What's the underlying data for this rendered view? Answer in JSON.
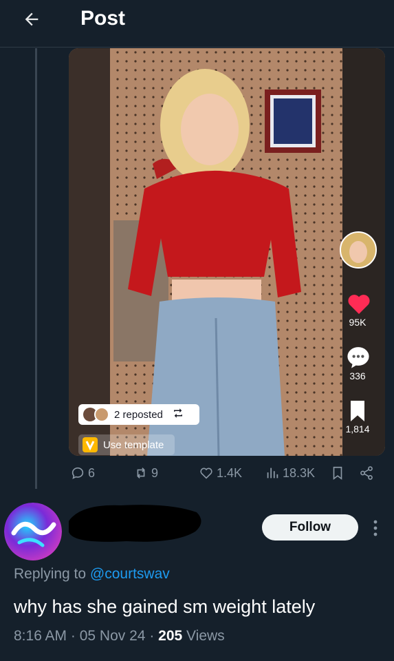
{
  "header": {
    "title": "Post",
    "back_icon": "arrow-left-icon"
  },
  "media": {
    "repost_chip": "2 reposted",
    "template_chip": "Use template",
    "side_stats": {
      "likes": "95K",
      "comments": "336",
      "saves": "1,814"
    }
  },
  "actions": {
    "replies": "6",
    "reposts": "9",
    "likes": "1.4K",
    "views": "18.3K"
  },
  "reply_post": {
    "follow_label": "Follow",
    "replying_prefix": "Replying to ",
    "replying_handle": "@courtswav",
    "text": "why has she gained sm weight lately",
    "time": "8:16 AM",
    "date": "05 Nov 24",
    "views_count": "205",
    "views_label": "Views"
  },
  "colors": {
    "background": "#15202b",
    "accent": "#1d9bf0",
    "muted": "#8b98a5"
  }
}
